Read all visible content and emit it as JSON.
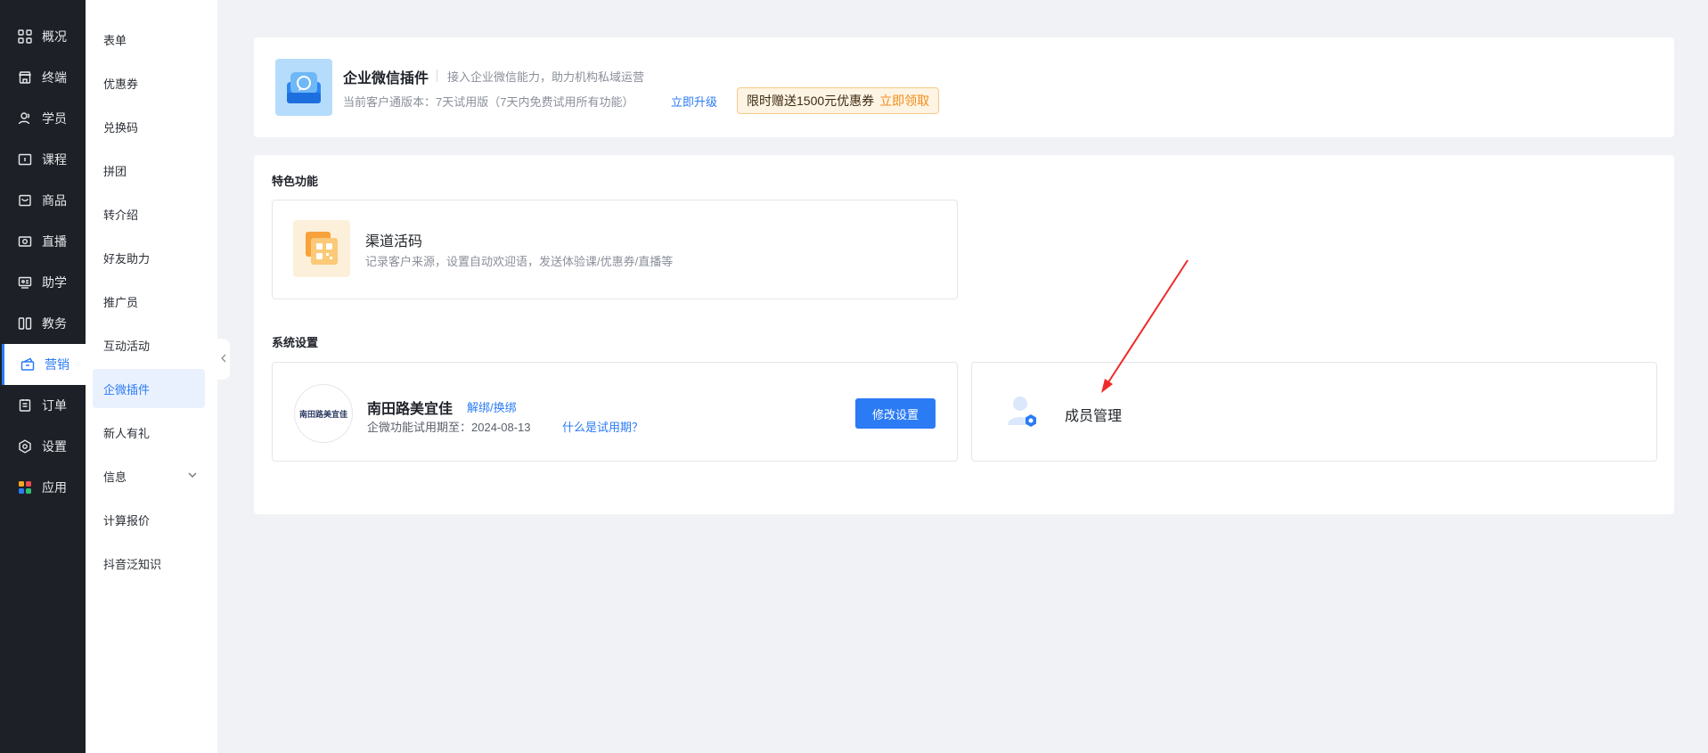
{
  "nav": {
    "items": [
      {
        "label": "概况",
        "icon": "grid-icon"
      },
      {
        "label": "终端",
        "icon": "store-icon"
      },
      {
        "label": "学员",
        "icon": "user-icon"
      },
      {
        "label": "课程",
        "icon": "course-icon"
      },
      {
        "label": "商品",
        "icon": "bag-icon"
      },
      {
        "label": "直播",
        "icon": "camera-icon"
      },
      {
        "label": "助学",
        "icon": "help-icon"
      },
      {
        "label": "教务",
        "icon": "book-icon"
      },
      {
        "label": "营销",
        "icon": "marketing-icon"
      },
      {
        "label": "订单",
        "icon": "order-icon"
      },
      {
        "label": "设置",
        "icon": "gear-icon"
      },
      {
        "label": "应用",
        "icon": "apps-icon"
      }
    ],
    "active_index": 8,
    "accent": "#2b7bf5",
    "background": "#1d2026"
  },
  "subnav": {
    "items": [
      "表单",
      "优惠券",
      "兑换码",
      "拼团",
      "转介绍",
      "好友助力",
      "推广员",
      "互动活动",
      "企微插件",
      "新人有礼",
      "信息",
      "计算报价",
      "抖音泛知识"
    ],
    "active_label": "企微插件"
  },
  "plugin": {
    "title": "企业微信插件",
    "desc": "接入企业微信能力，助力机构私域运营",
    "version_text": "当前客户通版本：7天试用版（7天内免费试用所有功能）",
    "upgrade_label": "立即升级",
    "promo_text": "限时赠送1500元优惠券",
    "promo_link": "立即领取"
  },
  "features": {
    "section_title": "特色功能",
    "channel": {
      "title": "渠道活码",
      "desc": "记录客户来源，设置自动欢迎语，发送体验课/优惠券/直播等"
    }
  },
  "system": {
    "section_title": "系统设置",
    "org": {
      "logo_text": "南田路美宜佳",
      "name": "南田路美宜佳",
      "bind_label": "解绑/换绑",
      "trial_text": "企微功能试用期至：2024-08-13",
      "trial_link": "什么是试用期？",
      "modify_label": "修改设置"
    },
    "member": {
      "title": "成员管理"
    }
  }
}
